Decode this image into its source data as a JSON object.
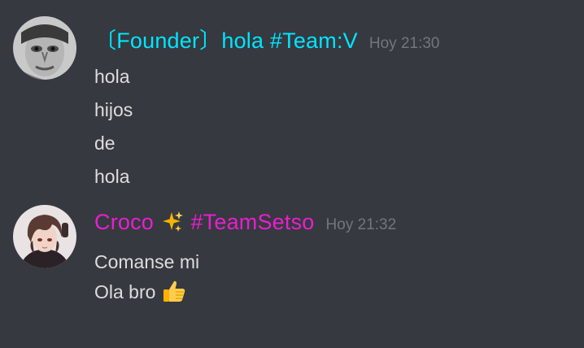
{
  "theme": {
    "background": "#36393f",
    "text": "#dcddde",
    "timestamp": "#72767d"
  },
  "messages": [
    {
      "author": "〔Founder〕hola #Team:V",
      "author_color": "#00e5ff",
      "timestamp": "Hoy 21:30",
      "avatar_icon": "grayscale-face-avatar",
      "lines": [
        "hola",
        "hijos",
        "de",
        "hola"
      ]
    },
    {
      "author_name": "Croco",
      "author_emoji": "sparkles-icon",
      "author_tag": "#TeamSetso",
      "author_color": "#e91ed1",
      "timestamp": "Hoy 21:32",
      "avatar_icon": "anime-character-avatar",
      "lines": [
        "Comanse mi",
        "Ola bro"
      ],
      "line_emoji": "thumbs-up-icon"
    }
  ]
}
